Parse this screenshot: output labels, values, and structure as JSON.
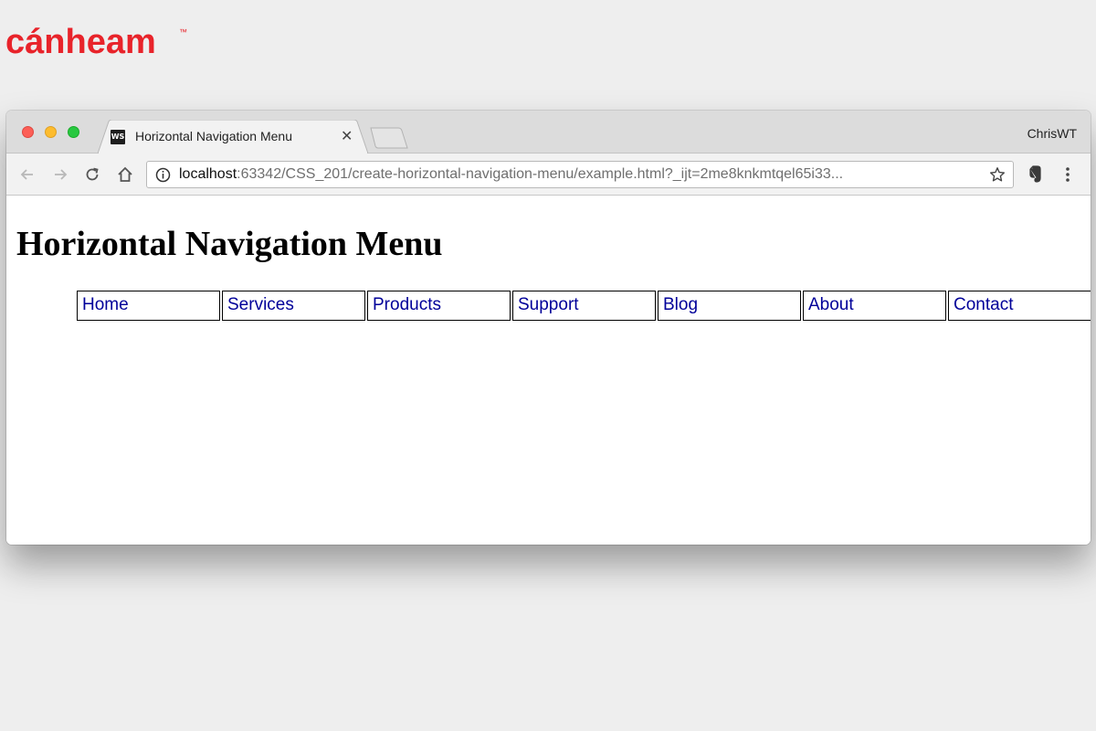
{
  "logo": {
    "text": "cánheam",
    "brand_color": "#e8232a",
    "trademark": "™"
  },
  "browser": {
    "tab": {
      "favicon_text": "WS",
      "title": "Horizontal Navigation Menu",
      "close_icon": "close-icon"
    },
    "profile_name": "ChrisWT",
    "toolbar": {
      "back_icon": "arrow-left-icon",
      "forward_icon": "arrow-right-icon",
      "reload_icon": "reload-icon",
      "home_icon": "home-icon",
      "info_icon": "info-icon",
      "url_host": "localhost",
      "url_rest": ":63342/CSS_201/create-horizontal-navigation-menu/example.html?_ijt=2me8knkmtqel65i33...",
      "bookmark_icon": "star-icon",
      "extension_icon": "evernote-icon",
      "menu_icon": "kebab-menu-icon"
    }
  },
  "page": {
    "heading": "Horizontal Navigation Menu",
    "nav_link_color": "#000099",
    "nav": [
      {
        "label": "Home"
      },
      {
        "label": "Services"
      },
      {
        "label": "Products"
      },
      {
        "label": "Support"
      },
      {
        "label": "Blog"
      },
      {
        "label": "About"
      },
      {
        "label": "Contact"
      }
    ]
  }
}
